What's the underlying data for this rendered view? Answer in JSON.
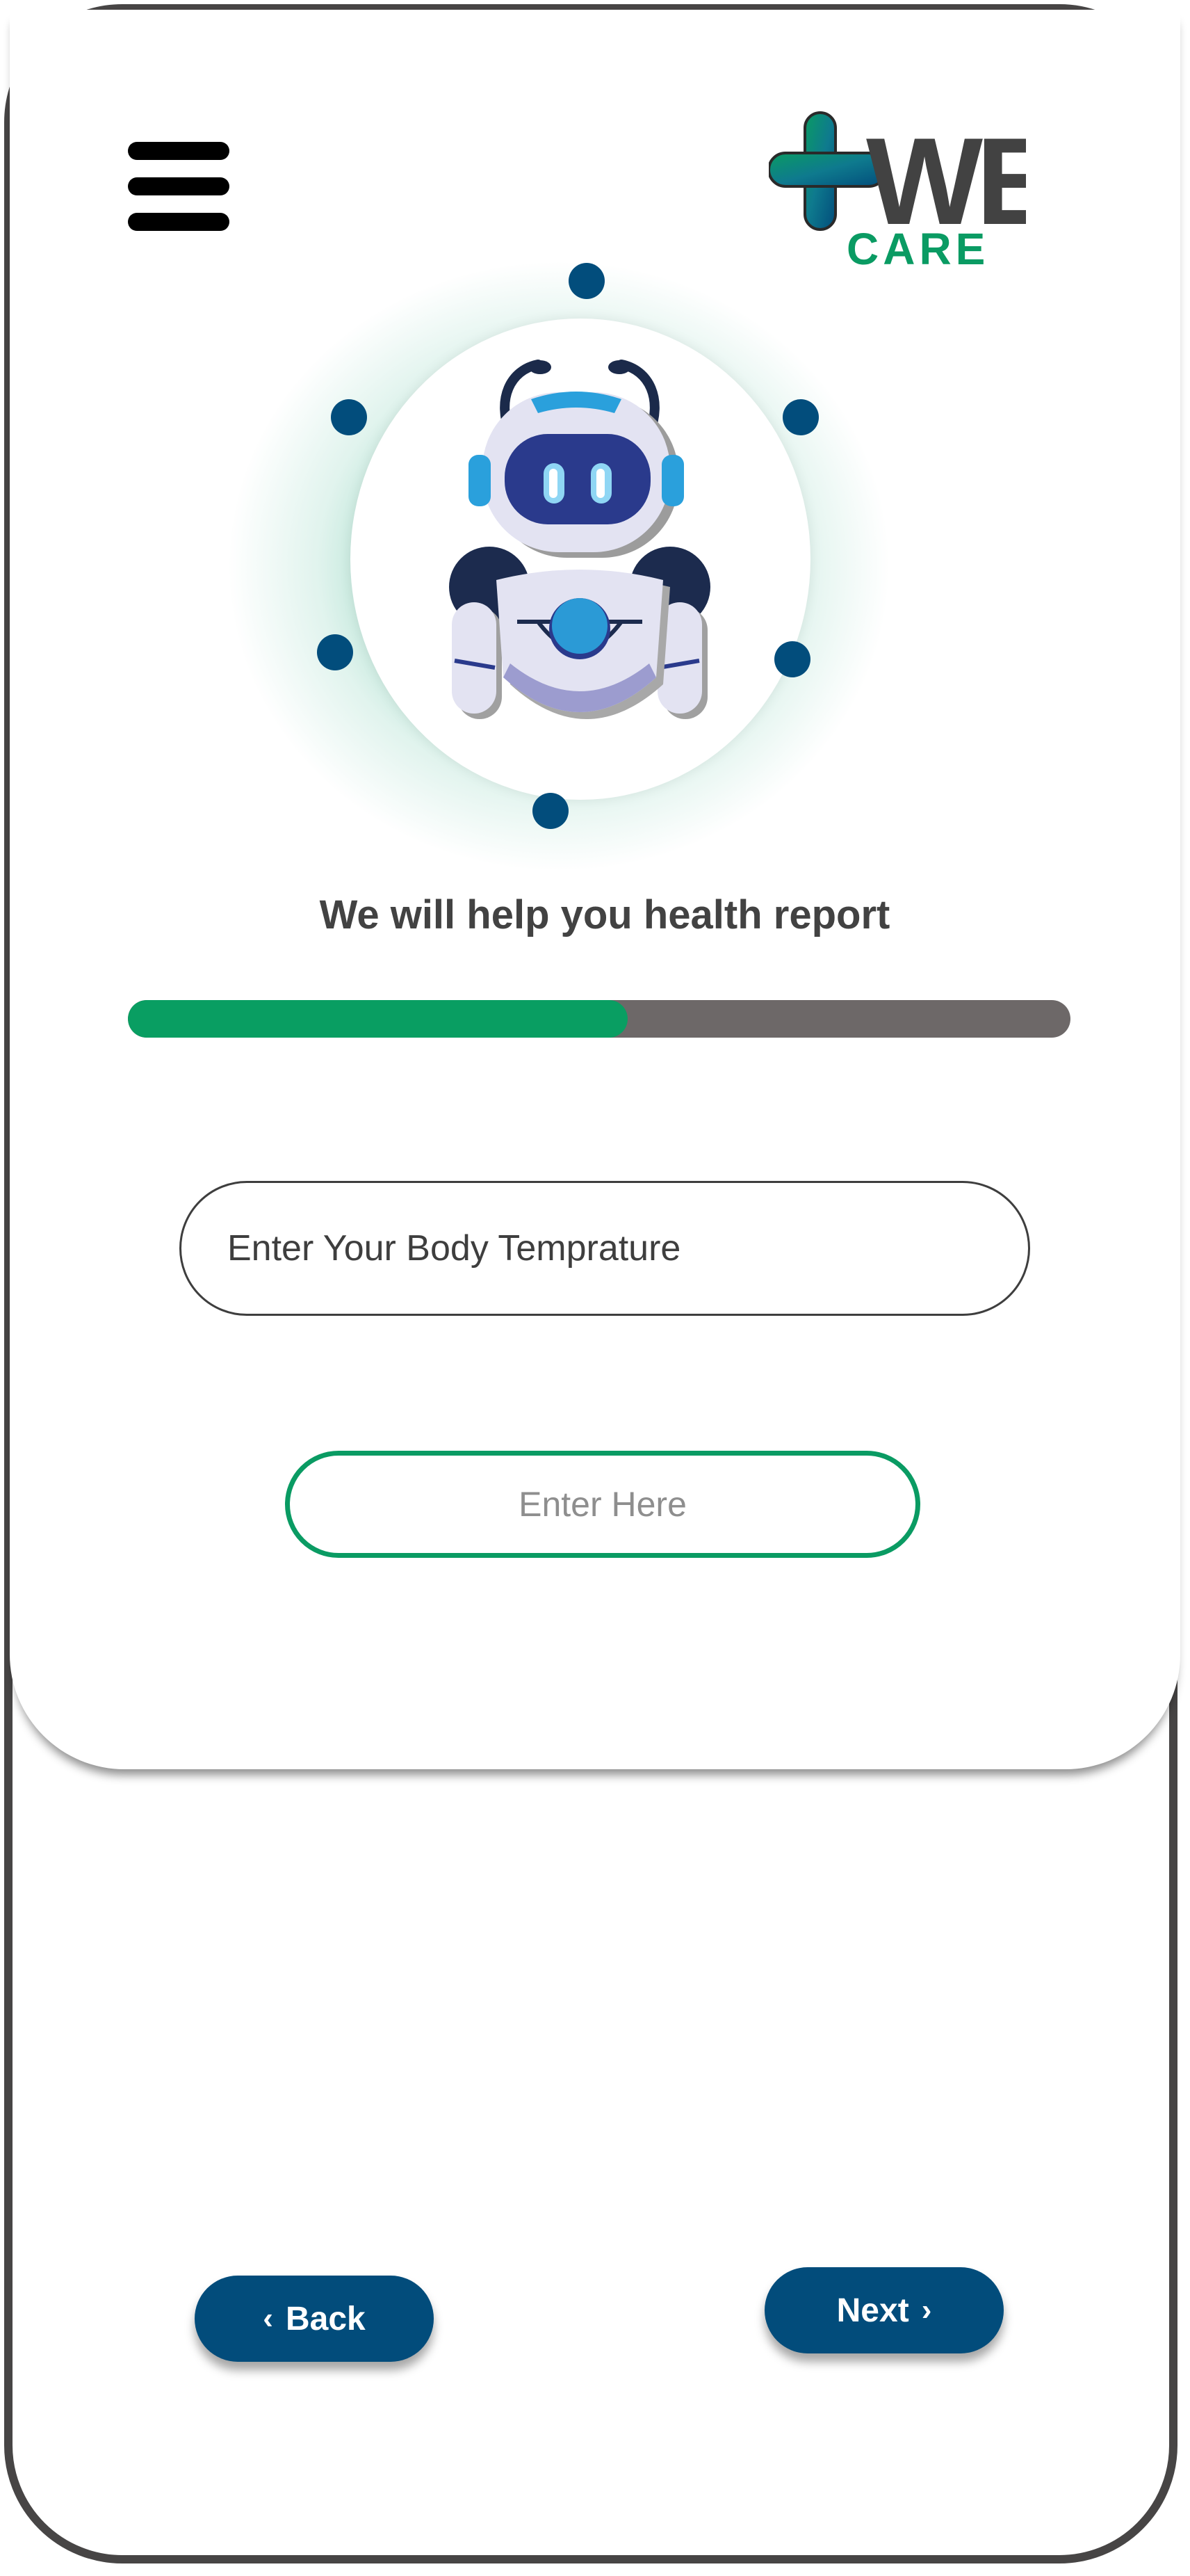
{
  "app": {
    "brand_logo_text": "WE CARE"
  },
  "header": {
    "menu_icon": "hamburger-menu-icon"
  },
  "assistant": {
    "image": "robot-assistant-icon"
  },
  "headline": "We will help you health report",
  "progress": {
    "fraction": 0.53
  },
  "question": {
    "label": "Enter Your Body Temprature"
  },
  "answer": {
    "placeholder": "Enter Here",
    "value": ""
  },
  "nav": {
    "back_label": "Back",
    "back_icon": "chevron-left-icon",
    "next_label": "Next",
    "next_icon": "chevron-right-icon"
  },
  "colors": {
    "primary": "#024c7b",
    "accent_green": "#099e62",
    "frame": "#474545",
    "track": "#6d6868"
  }
}
